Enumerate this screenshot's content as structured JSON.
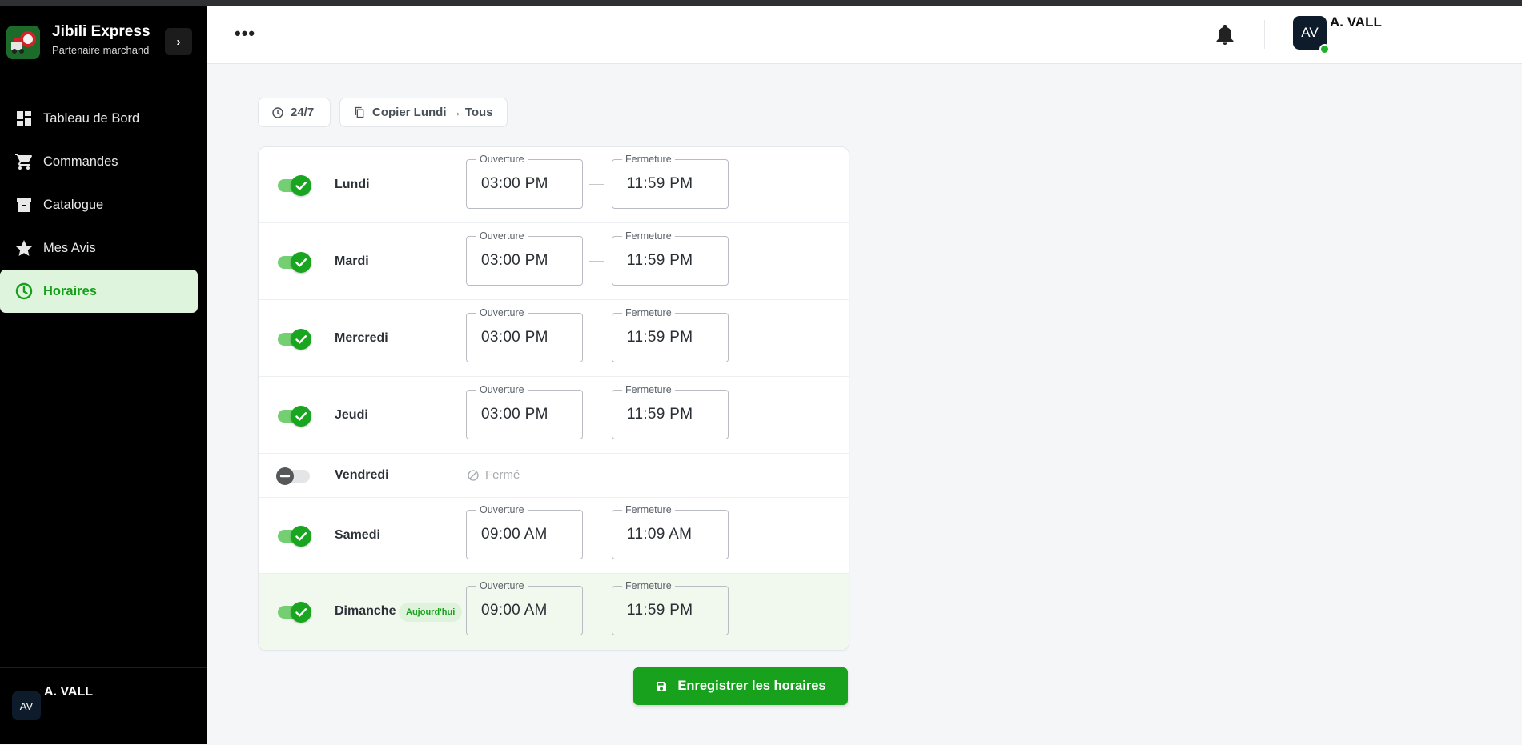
{
  "brand": {
    "name": "Jibili Express",
    "subtitle": "Partenaire marchand",
    "collapse_glyph": "›"
  },
  "sidebar": {
    "items": [
      {
        "label": "Tableau de Bord",
        "icon": "dashboard-icon",
        "active": false
      },
      {
        "label": "Commandes",
        "icon": "cart-icon",
        "active": false
      },
      {
        "label": "Catalogue",
        "icon": "archive-box-icon",
        "active": false
      },
      {
        "label": "Mes Avis",
        "icon": "star-icon",
        "active": false
      },
      {
        "label": "Horaires",
        "icon": "clock-icon",
        "active": true
      }
    ],
    "footer": {
      "initials": "AV",
      "name": "A. VALL"
    }
  },
  "header": {
    "more_label": "•••",
    "user_initials": "AV",
    "user_name": "A. VALL"
  },
  "toolbar": {
    "always_open_label": "24/7",
    "copy_label": "Copier Lundi → Tous"
  },
  "schedule": {
    "open_label": "Ouverture",
    "close_label": "Fermeture",
    "closed_label": "Fermé",
    "today_badge": "Aujourd'hui",
    "days": [
      {
        "day": "Lundi",
        "enabled": true,
        "open": "03:00 PM",
        "close": "11:59 PM"
      },
      {
        "day": "Mardi",
        "enabled": true,
        "open": "03:00 PM",
        "close": "11:59 PM"
      },
      {
        "day": "Mercredi",
        "enabled": true,
        "open": "03:00 PM",
        "close": "11:59 PM"
      },
      {
        "day": "Jeudi",
        "enabled": true,
        "open": "03:00 PM",
        "close": "11:59 PM"
      },
      {
        "day": "Vendredi",
        "enabled": false
      },
      {
        "day": "Samedi",
        "enabled": true,
        "open": "09:00 AM",
        "close": "11:09 AM"
      },
      {
        "day": "Dimanche",
        "enabled": true,
        "open": "09:00 AM",
        "close": "11:59 PM",
        "today": true
      }
    ]
  },
  "actions": {
    "save_label": "Enregistrer les horaires"
  },
  "colors": {
    "accent": "#17a11c",
    "accent_light": "#dff4dc",
    "sidebar_bg": "#000000",
    "avatar_bg": "#0e1b2a"
  }
}
